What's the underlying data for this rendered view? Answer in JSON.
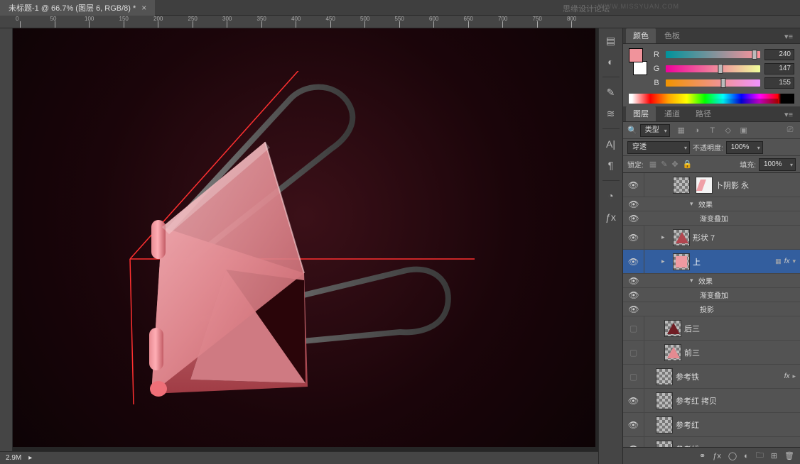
{
  "doc": {
    "title": "未标题-1 @ 66.7% (图层 6, RGB/8) *",
    "close": "×"
  },
  "ruler_ticks": [
    "0",
    "50",
    "100",
    "150",
    "200",
    "250",
    "300",
    "350",
    "400",
    "450",
    "500",
    "550",
    "600",
    "650",
    "700",
    "750",
    "800"
  ],
  "status": {
    "zoom": "2.9M"
  },
  "watermark1": "思缘设计论坛",
  "watermark2": "WWW.MISSYUAN.COM",
  "color_panel": {
    "tabs": [
      "颜色",
      "色板"
    ],
    "R": {
      "label": "R",
      "value": "240",
      "pos": 94
    },
    "G": {
      "label": "G",
      "value": "147",
      "pos": 58
    },
    "B": {
      "label": "B",
      "value": "155",
      "pos": 61
    }
  },
  "layers_panel": {
    "tabs": [
      "图层",
      "通道",
      "路径"
    ],
    "filter_label": "类型",
    "blend_label": "穿透",
    "opacity_label": "不透明度:",
    "opacity_value": "100%",
    "lock_label": "锁定:",
    "fill_label": "填充:",
    "fill_value": "100%",
    "search_icon": "🔍",
    "layers": [
      {
        "type": "row",
        "vis": true,
        "indent": 36,
        "thumbs": [
          "checker",
          "white"
        ],
        "name": "卜阴影 永",
        "twist": ""
      },
      {
        "type": "sub",
        "vis": true,
        "indent": 64,
        "name": "效果",
        "twist": "▾"
      },
      {
        "type": "sub",
        "vis": true,
        "indent": 78,
        "name": "渐变叠加"
      },
      {
        "type": "row",
        "vis": true,
        "indent": 24,
        "thumbs": [
          "checker-tri"
        ],
        "name": "形状 7",
        "twist": "▸"
      },
      {
        "type": "row",
        "vis": true,
        "indent": 24,
        "thumbs": [
          "checker-pink"
        ],
        "name": "上",
        "selected": true,
        "twist": "▸",
        "badges": [
          "▦",
          "fx",
          "▾"
        ]
      },
      {
        "type": "sub",
        "vis": true,
        "indent": 64,
        "name": "效果",
        "twist": "▾"
      },
      {
        "type": "sub",
        "vis": true,
        "indent": 78,
        "name": "渐变叠加"
      },
      {
        "type": "sub",
        "vis": true,
        "indent": 78,
        "name": "投影"
      },
      {
        "type": "row",
        "vis": "box",
        "indent": 24,
        "thumbs": [
          "checker-tri2"
        ],
        "name": "后三"
      },
      {
        "type": "row",
        "vis": "box",
        "indent": 24,
        "thumbs": [
          "checker-tri3"
        ],
        "name": "前三"
      },
      {
        "type": "row",
        "vis": "box",
        "indent": 12,
        "thumbs": [
          "checker"
        ],
        "name": "参考铁",
        "badges": [
          "fx",
          "▸"
        ]
      },
      {
        "type": "row",
        "vis": true,
        "indent": 12,
        "thumbs": [
          "checker"
        ],
        "name": "参考红 拷贝"
      },
      {
        "type": "row",
        "vis": true,
        "indent": 12,
        "thumbs": [
          "checker"
        ],
        "name": "参考红"
      },
      {
        "type": "row",
        "vis": true,
        "indent": 12,
        "thumbs": [
          "checker"
        ],
        "name": "参考线"
      }
    ]
  }
}
